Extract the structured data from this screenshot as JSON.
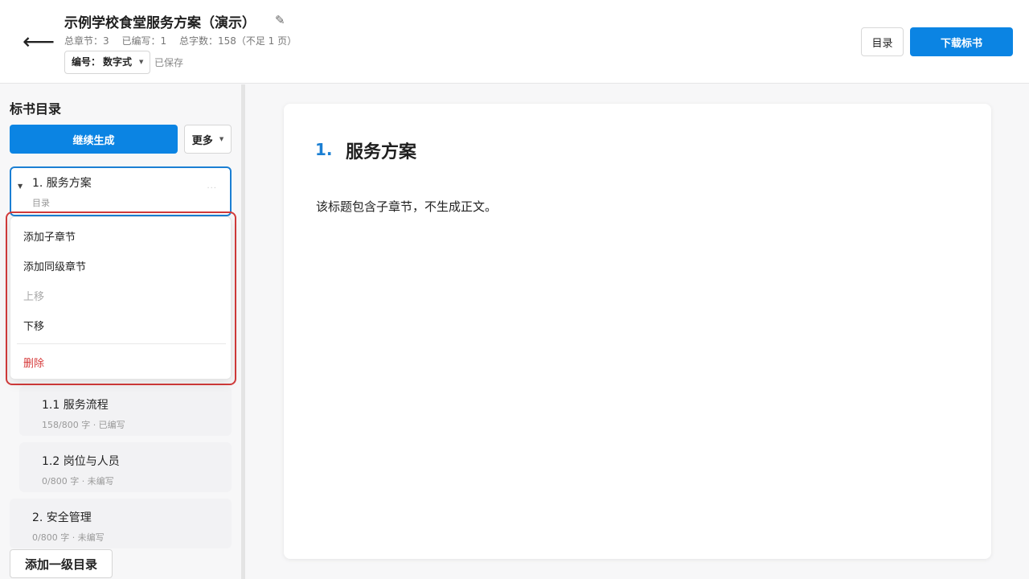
{
  "header": {
    "back_icon": "arrow-left-icon",
    "back_glyph": "⟵",
    "title": "示例学校食堂服务方案（演示）",
    "edit_glyph": "✎",
    "stats": {
      "chapters": "总章节：3",
      "written": "已编写：1",
      "words": "总字数：158（不足 1 页）"
    },
    "numbering": {
      "label": "编号：",
      "value": "数字式"
    },
    "saved": "已保存",
    "toc_button": "目录",
    "download_button": "下载标书"
  },
  "sidebar": {
    "title": "标书目录",
    "continue_button": "继续生成",
    "more_button": "更多",
    "items": [
      {
        "title": "1. 服务方案",
        "meta": "目录"
      },
      {
        "title": "1.1 服务流程",
        "meta": "158/800 字 · 已编写"
      },
      {
        "title": "1.2 岗位与人员",
        "meta": "0/800 字 · 未编写"
      },
      {
        "title": "2. 安全管理",
        "meta": "0/800 字 · 未编写"
      }
    ],
    "add_level1_button": "添加一级目录"
  },
  "context_menu": {
    "add_child": "添加子章节",
    "add_sibling": "添加同级章节",
    "move_up": "上移",
    "move_down": "下移",
    "delete": "删除"
  },
  "main": {
    "heading_number": "1.",
    "heading_text": "服务方案",
    "body": "该标题包含子章节，不生成正文。"
  },
  "colors": {
    "primary": "#0b84e3",
    "active_border": "#1b7fd3",
    "highlight_border": "#d23a3a",
    "danger_text": "#d63b3b"
  }
}
